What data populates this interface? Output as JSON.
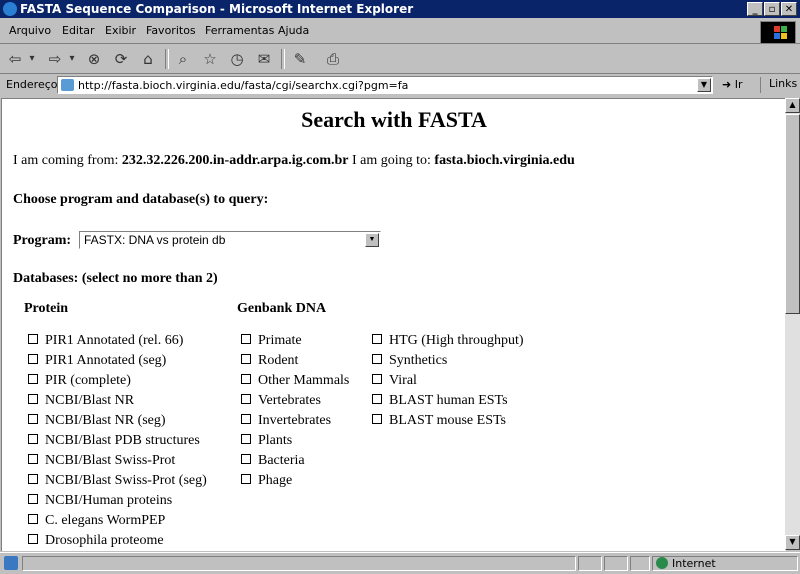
{
  "window": {
    "title": "FASTA Sequence Comparison - Microsoft Internet Explorer",
    "buttons": [
      "_",
      "▫",
      "✕"
    ]
  },
  "menu": [
    {
      "label": "Arquivo"
    },
    {
      "label": "Editar"
    },
    {
      "label": "Exibir"
    },
    {
      "label": "Favoritos"
    },
    {
      "label": "Ferramentas"
    },
    {
      "label": "Ajuda"
    }
  ],
  "toolbar": {
    "back": "⇦",
    "back_drop": "▾",
    "forward": "⇨",
    "forward_drop": "▾",
    "stop": "⊗",
    "refresh": "⟳",
    "home": "⌂",
    "search": "⌕",
    "favorites": "☆",
    "history": "◷",
    "mail": "✉",
    "edit": "✎",
    "print": "⎙"
  },
  "address": {
    "label": "Endereço",
    "url": "http://fasta.bioch.virginia.edu/fasta/cgi/searchx.cgi?pgm=fa",
    "go_label": "Ir",
    "go_icon": "➜",
    "links_label": "Links"
  },
  "page": {
    "heading": "Search with FASTA",
    "coming_prefix": "I am coming from:",
    "coming_host": "232.32.226.200.in-addr.arpa.ig.com.br",
    "going_prefix": "I am going to:",
    "going_host": "fasta.bioch.virginia.edu",
    "choose_label": "Choose program and database(s) to query:",
    "program_label": "Program:",
    "program_value": "FASTX: DNA vs protein db",
    "databases_label": "Databases: (select no more than 2)",
    "protein_header": "Protein",
    "genbank_header": "Genbank DNA",
    "protein_dbs": [
      "PIR1 Annotated (rel. 66)",
      "PIR1 Annotated (seg)",
      "PIR (complete)",
      "NCBI/Blast NR",
      "NCBI/Blast NR (seg)",
      "NCBI/Blast PDB structures",
      "NCBI/Blast Swiss-Prot",
      "NCBI/Blast Swiss-Prot (seg)",
      "NCBI/Human proteins",
      "C. elegans WormPEP",
      "Drosophila proteome"
    ],
    "genbank_dbs_1": [
      "Primate",
      "Rodent",
      "Other Mammals",
      "Vertebrates",
      "Invertebrates",
      "Plants",
      "Bacteria",
      "Phage"
    ],
    "genbank_dbs_2": [
      "HTG (High throughput)",
      "Synthetics",
      "Viral",
      "BLAST human ESTs",
      "BLAST mouse ESTs"
    ]
  },
  "status": {
    "zone": "Internet"
  }
}
